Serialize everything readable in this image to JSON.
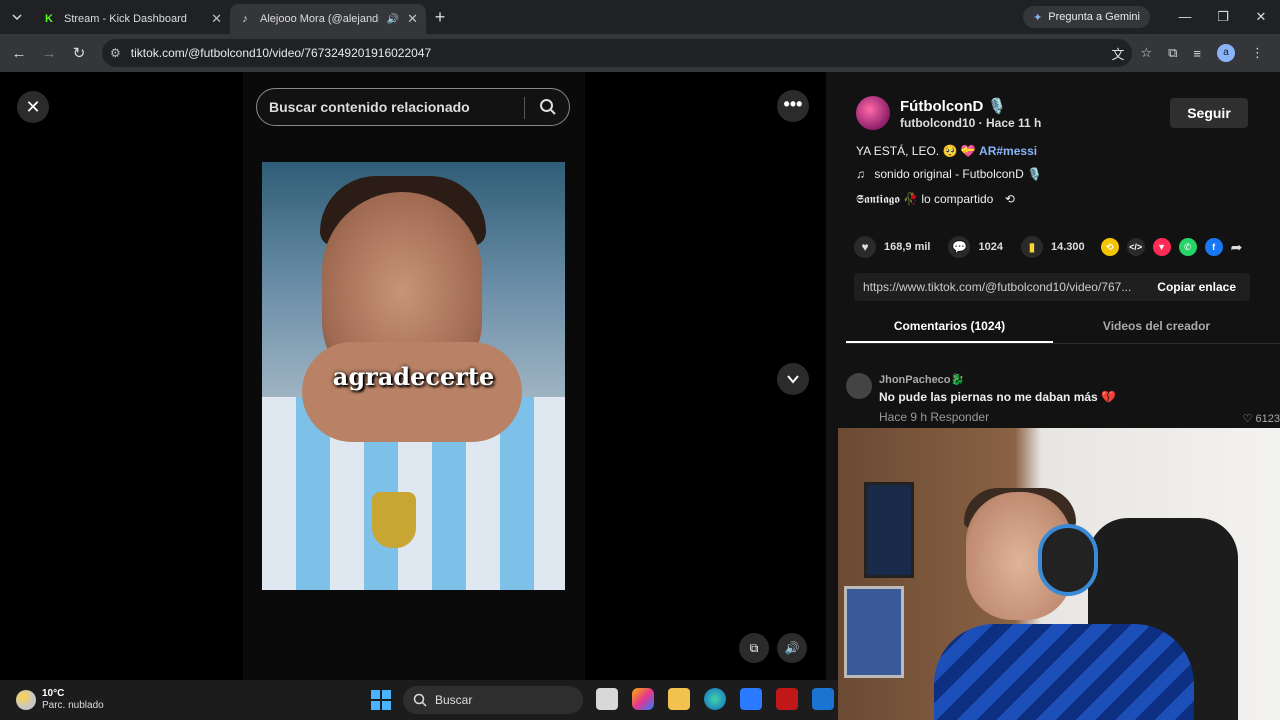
{
  "browser": {
    "tabs": [
      {
        "title": "Stream - Kick Dashboard",
        "favicon": "kick-icon",
        "active": false
      },
      {
        "title": "Alejooo Mora (@alejandron",
        "favicon": "tiktok-icon",
        "active": true
      }
    ],
    "gemini_label": "Pregunta a Gemini",
    "url": "tiktok.com/@futbolcond10/video/7673249201916022047"
  },
  "viewer": {
    "search_placeholder": "Buscar contenido relacionado",
    "caption": "agradecerte"
  },
  "panel": {
    "creator_name": "FútbolconD 🎙️",
    "creator_meta": "futbolcond10 · Hace 11 h",
    "follow_label": "Seguir",
    "description": "YA ESTÁ, LEO. 🥺 💝",
    "description_tag": "AR#messi",
    "sound": "sonido original - FutbolconD 🎙️",
    "shared_by": "𝕾𝖆𝖓𝖙𝖎𝖆𝖌𝖔 🥀 lo compartido",
    "likes": "168,9 mil",
    "comments": "1024",
    "saves": "14.300",
    "link": "https://www.tiktok.com/@futbolcond10/video/767...",
    "copy_label": "Copiar enlace",
    "tab_comments": "Comentarios (1024)",
    "tab_videos": "Videos del creador",
    "comment": {
      "user": "JhonPacheco🐉",
      "text": "No pude las piernas no me daban más 💔",
      "meta": "Hace 9 h   Responder",
      "likes": "♡ 6123"
    }
  },
  "taskbar": {
    "temp": "10°C",
    "condition": "Parc. nublado",
    "search_label": "Buscar"
  },
  "colors": {
    "accent": "#8ab4f8",
    "kick_green": "#53fc18",
    "tiktok_save": "#fcd535"
  }
}
